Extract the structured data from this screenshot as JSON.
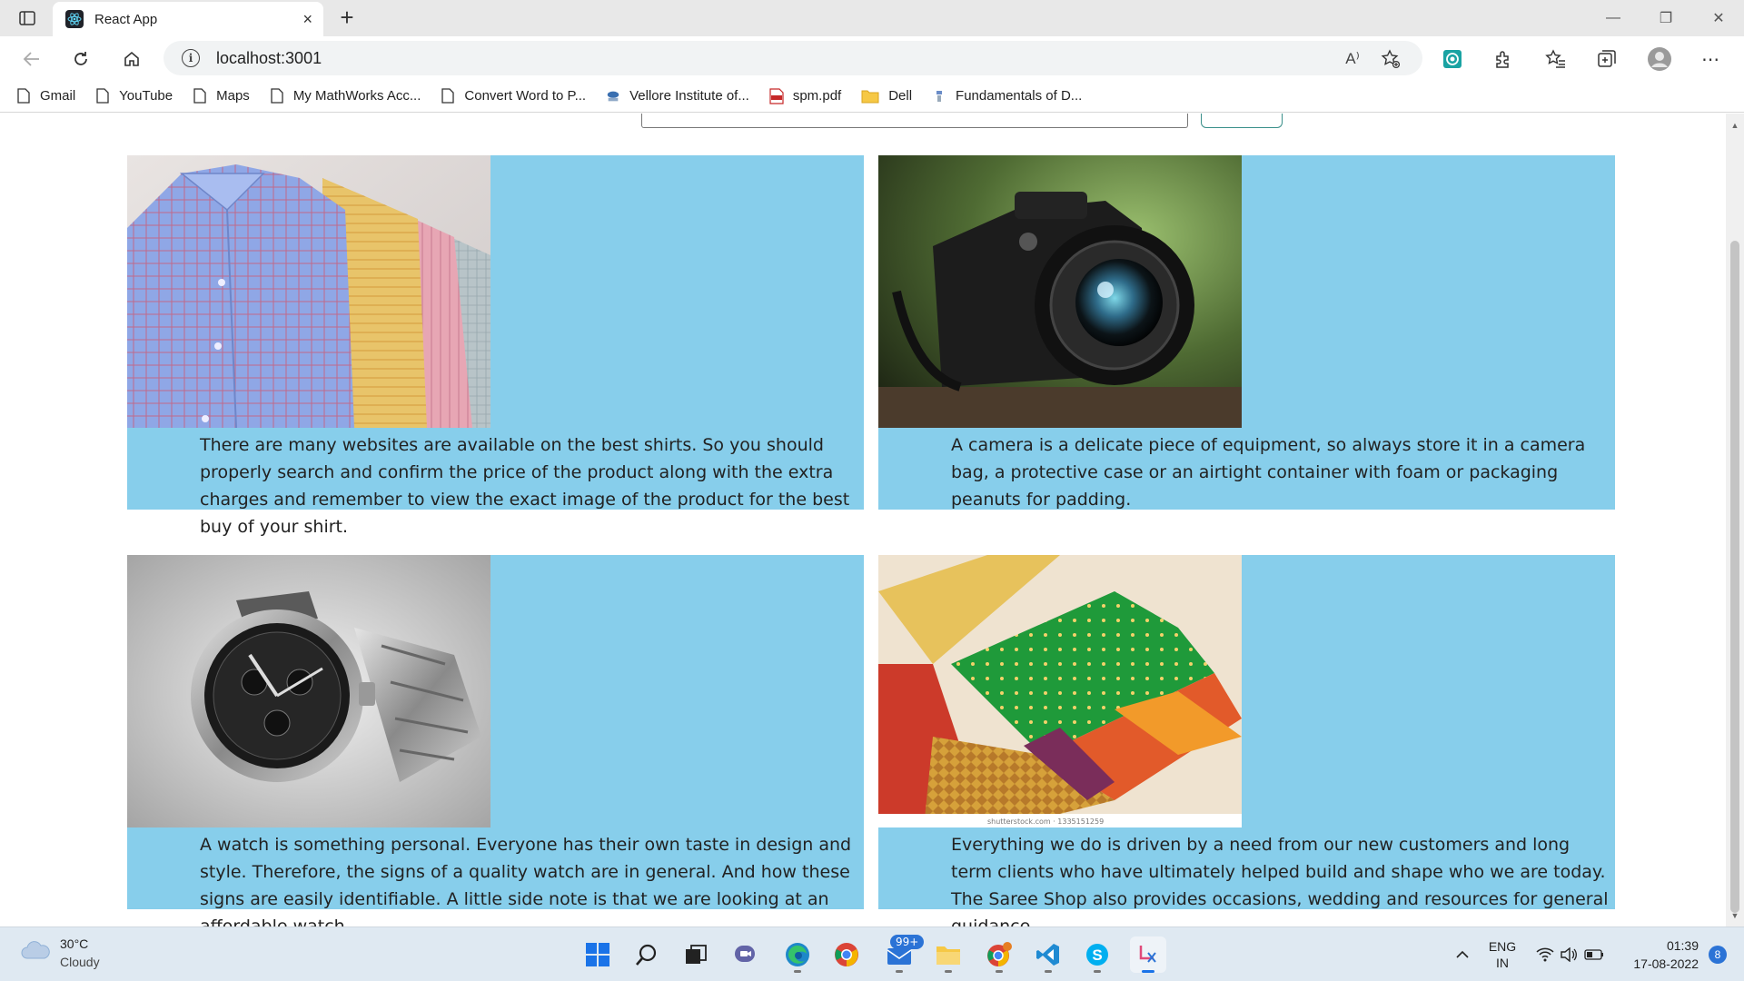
{
  "browser": {
    "tab_title": "React App",
    "tab_close": "×",
    "new_tab": "+",
    "url": "localhost:3001",
    "info_glyph": "i",
    "read_aloud": "A⁾",
    "menu_dots": "⋯",
    "window_minimize": "—",
    "window_restore": "❐",
    "window_close": "✕",
    "bookmarks": [
      {
        "label": "Gmail",
        "icon": "page-icon"
      },
      {
        "label": "YouTube",
        "icon": "page-icon"
      },
      {
        "label": "Maps",
        "icon": "page-icon"
      },
      {
        "label": "My MathWorks Acc...",
        "icon": "page-icon"
      },
      {
        "label": "Convert Word to P...",
        "icon": "page-icon"
      },
      {
        "label": "Vellore Institute of...",
        "icon": "vit-icon"
      },
      {
        "label": "spm.pdf",
        "icon": "pdf-icon"
      },
      {
        "label": "Dell",
        "icon": "folder-icon"
      },
      {
        "label": "Fundamentals of D...",
        "icon": "book-icon"
      }
    ]
  },
  "products": [
    {
      "image": "shirts",
      "description": "There are many websites are available on the best shirts. So you should properly search and confirm the price of the product along with the extra charges and remember to view the exact image of the product for the best buy of your shirt."
    },
    {
      "image": "camera",
      "description": "A camera is a delicate piece of equipment, so always store it in a camera bag, a protective case or an airtight container with foam or packaging peanuts for padding."
    },
    {
      "image": "watch",
      "description": "A watch is something personal. Everyone has their own taste in design and style. Therefore, the signs of a quality watch are in general. And how these signs are easily identifiable. A little side note is that we are looking at an affordable watch."
    },
    {
      "image": "saree",
      "description": "Everything we do is driven by a need from our new customers and long term clients who have ultimately helped build and shape who we are today. The Saree Shop also provides occasions, wedding and resources for general guidance."
    }
  ],
  "watermark": "shutterstock.com · 1335151259",
  "taskbar": {
    "weather_temp": "30°C",
    "weather_condition": "Cloudy",
    "mail_badge": "99+",
    "lang_top": "ENG",
    "lang_bottom": "IN",
    "time": "01:39",
    "date": "17-08-2022",
    "notification_count": "8"
  },
  "colors": {
    "card_background": "#87ceeb",
    "tab_strip": "#e8e8e8",
    "taskbar": "#dfe9f2"
  }
}
